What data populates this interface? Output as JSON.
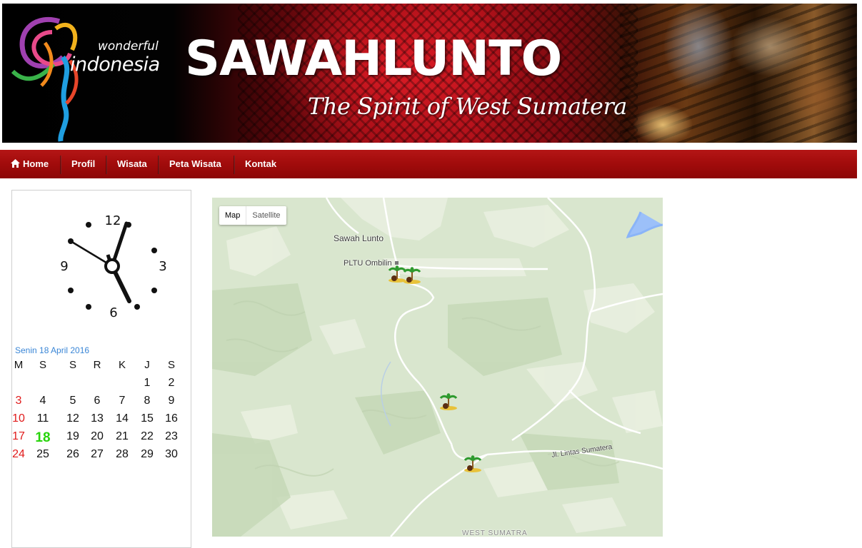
{
  "header": {
    "logo_small": "wonderful",
    "logo_large": "indonesia",
    "title": "SAWAHLUNTO",
    "tagline": "The Spirit of West Sumatera"
  },
  "nav": {
    "items": [
      {
        "label": "Home",
        "icon": "home-icon"
      },
      {
        "label": "Profil"
      },
      {
        "label": "Wisata"
      },
      {
        "label": "Peta Wisata"
      },
      {
        "label": "Kontak"
      }
    ]
  },
  "clock": {
    "numerals": [
      "12",
      "3",
      "6",
      "9"
    ],
    "time_shown": "5:49"
  },
  "calendar": {
    "title": "Senin 18 April 2016",
    "weekdays": [
      "M",
      "S",
      "S",
      "R",
      "K",
      "J",
      "S"
    ],
    "weeks": [
      [
        "",
        "",
        "",
        "",
        "",
        "1",
        "2"
      ],
      [
        "3",
        "4",
        "5",
        "6",
        "7",
        "8",
        "9"
      ],
      [
        "10",
        "11",
        "12",
        "13",
        "14",
        "15",
        "16"
      ],
      [
        "17",
        "18",
        "19",
        "20",
        "21",
        "22",
        "23"
      ],
      [
        "24",
        "25",
        "26",
        "27",
        "28",
        "29",
        "30"
      ]
    ],
    "today": "18",
    "colors": {
      "sunday": "#e01b1b",
      "today": "#27d40a",
      "title": "#3a86d6"
    }
  },
  "map": {
    "controls": {
      "map": "Map",
      "satellite": "Satellite"
    },
    "labels": {
      "town": "Sawah Lunto",
      "poi": "PLTU Ombilin",
      "road": "Jl. Lintas Sumatera",
      "region": "WEST SUMATRA"
    },
    "marker_icon": "palm-island-icon"
  },
  "colors": {
    "nav": "#a30c0c",
    "banner_red": "#b2111a"
  }
}
